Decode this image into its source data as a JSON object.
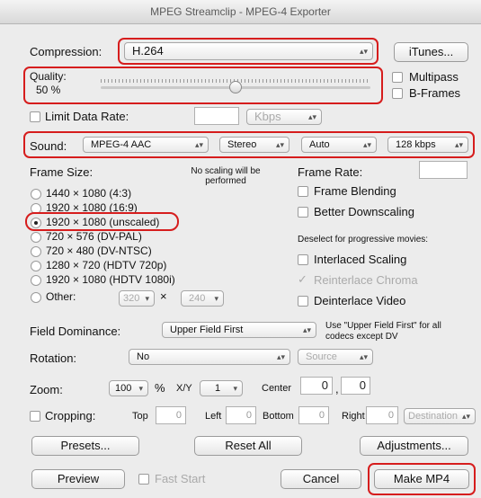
{
  "window": {
    "title": "MPEG Streamclip - MPEG-4 Exporter"
  },
  "compression": {
    "label": "Compression:",
    "value": "H.264",
    "itunes_button": "iTunes..."
  },
  "quality": {
    "label": "Quality:",
    "value": "50 %",
    "level": 0.5,
    "multipass": "Multipass",
    "bframes": "B-Frames"
  },
  "limit": {
    "label": "Limit Data Rate:",
    "unit": "Kbps"
  },
  "sound": {
    "label": "Sound:",
    "codec": "MPEG-4 AAC",
    "channels": "Stereo",
    "rate": "Auto",
    "bitrate": "128 kbps"
  },
  "frame_size": {
    "label": "Frame Size:",
    "note": "No scaling will be performed",
    "options": [
      "1440 × 1080  (4:3)",
      "1920 × 1080  (16:9)",
      "1920 × 1080  (unscaled)",
      "720 × 576  (DV-PAL)",
      "720 × 480  (DV-NTSC)",
      "1280 × 720  (HDTV 720p)",
      "1920 × 1080  (HDTV 1080i)"
    ],
    "other": {
      "label": "Other:",
      "width": "320",
      "times": "×",
      "height": "240"
    }
  },
  "frame_rate": {
    "label": "Frame Rate:",
    "blending": "Frame Blending",
    "downscaling": "Better Downscaling",
    "deselect_note": "Deselect for progressive movies:",
    "interlaced": "Interlaced Scaling",
    "reinterlace": "Reinterlace Chroma",
    "deinterlace": "Deinterlace Video"
  },
  "field_dominance": {
    "label": "Field Dominance:",
    "value": "Upper Field First",
    "note": "Use \"Upper Field First\" for all codecs except DV"
  },
  "rotation": {
    "label": "Rotation:",
    "value": "No",
    "source": "Source"
  },
  "zoom": {
    "label": "Zoom:",
    "value": "100",
    "percent": "%",
    "xy_label": "X/Y",
    "xy_value": "1",
    "center_label": "Center",
    "center_x": "0",
    "comma": ",",
    "center_y": "0"
  },
  "cropping": {
    "label": "Cropping:",
    "top_label": "Top",
    "top": "0",
    "left_label": "Left",
    "left": "0",
    "bottom_label": "Bottom",
    "bottom": "0",
    "right_label": "Right",
    "right": "0",
    "destination": "Destination"
  },
  "buttons": {
    "presets": "Presets...",
    "reset": "Reset All",
    "adjustments": "Adjustments...",
    "preview": "Preview",
    "fast_start": "Fast Start",
    "cancel": "Cancel",
    "make": "Make MP4"
  }
}
